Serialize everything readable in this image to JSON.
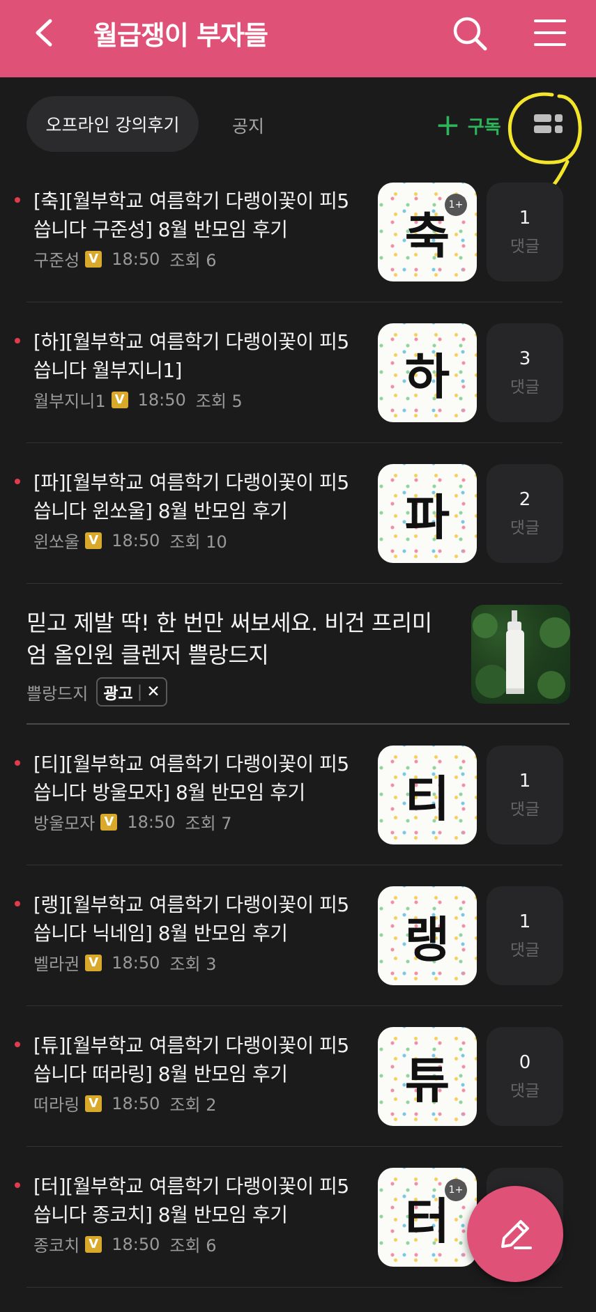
{
  "appbar": {
    "title": "월급쟁이 부자들",
    "back_icon": "back-arrow-icon",
    "search_icon": "search-icon",
    "menu_icon": "hamburger-menu-icon"
  },
  "tabs": {
    "active": "오프라인 강의후기",
    "notice": "공지"
  },
  "subscribe": {
    "plus": "+",
    "label": "구독"
  },
  "view_toggle_icon": "grid-view-icon",
  "comment_label": "댓글",
  "posts": [
    {
      "title": "[축][월부학교 여름학기 다랭이꽃이 피5씁니다 구준성] 8월 반모임 후기",
      "author": "구준성",
      "badge": "V",
      "time": "18:50",
      "views": "조회 6",
      "thumb_char": "축",
      "thumb_more": "1+",
      "comments": "1"
    },
    {
      "title": "[하][월부학교 여름학기 다랭이꽃이 피5씁니다 월부지니1]",
      "author": "월부지니1",
      "badge": "V",
      "time": "18:50",
      "views": "조회 5",
      "thumb_char": "하",
      "thumb_more": "",
      "comments": "3"
    },
    {
      "title": "[파][월부학교 여름학기 다랭이꽃이 피5씁니다 윈쏘울] 8월 반모임 후기",
      "author": "윈쏘울",
      "badge": "V",
      "time": "18:50",
      "views": "조회 10",
      "thumb_char": "파",
      "thumb_more": "",
      "comments": "2"
    },
    {
      "title": "[티][월부학교 여름학기 다랭이꽃이 피5씁니다 방울모자] 8월 반모임 후기",
      "author": "방울모자",
      "badge": "V",
      "time": "18:50",
      "views": "조회 7",
      "thumb_char": "티",
      "thumb_more": "",
      "comments": "1"
    },
    {
      "title": "[랭][월부학교 여름학기 다랭이꽃이 피5씁니다 닉네임] 8월 반모임 후기",
      "author": "벨라권",
      "badge": "V",
      "time": "18:50",
      "views": "조회 3",
      "thumb_char": "랭",
      "thumb_more": "",
      "comments": "1"
    },
    {
      "title": "[튜][월부학교 여름학기 다랭이꽃이 피5씁니다 떠라링] 8월 반모임 후기",
      "author": "떠라링",
      "badge": "V",
      "time": "18:50",
      "views": "조회 2",
      "thumb_char": "튜",
      "thumb_more": "",
      "comments": "0"
    },
    {
      "title": "[터][월부학교 여름학기 다랭이꽃이 피5씁니다 종코치] 8월 반모임 후기",
      "author": "종코치",
      "badge": "V",
      "time": "18:50",
      "views": "조회 6",
      "thumb_char": "터",
      "thumb_more": "1+",
      "comments": ""
    }
  ],
  "ad": {
    "title": "믿고 제발 딱! 한 번만 써보세요. 비건 프리미엄 올인원 클렌저 쁠랑드지",
    "advertiser": "쁠랑드지",
    "badge": "광고",
    "close": "✕"
  },
  "fab_icon": "pencil-write-icon",
  "colors": {
    "accent": "#e05177",
    "subscribe": "#2cb55a",
    "new_dot": "#e23b4b",
    "badge": "#d8a92a",
    "background": "#1b1b1c"
  }
}
